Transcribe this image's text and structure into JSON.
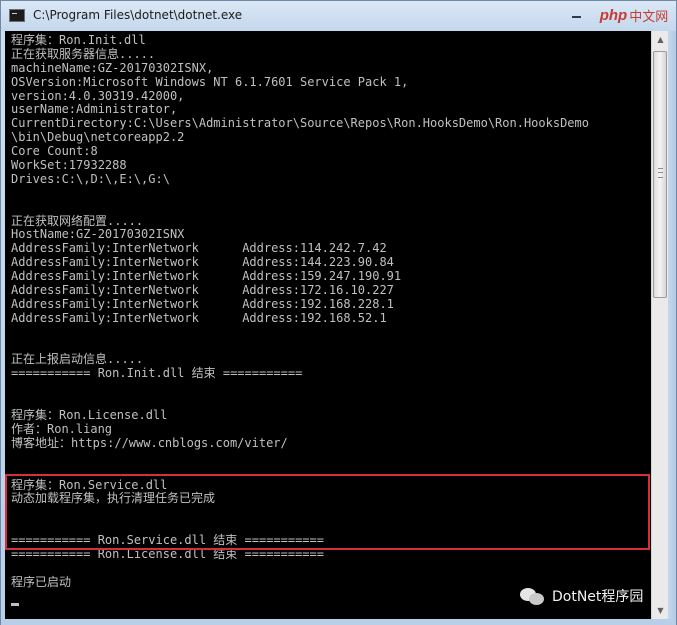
{
  "window": {
    "title": "C:\\Program Files\\dotnet\\dotnet.exe",
    "watermark": {
      "brand": "php",
      "suffix": "中文网"
    }
  },
  "console": {
    "lines": [
      "程序集：Ron.Init.dll",
      "正在获取服务器信息.....",
      "machineName:GZ-20170302ISNX,",
      "OSVersion:Microsoft Windows NT 6.1.7601 Service Pack 1,",
      "version:4.0.30319.42000,",
      "userName:Administrator,",
      "CurrentDirectory:C:\\Users\\Administrator\\Source\\Repos\\Ron.HooksDemo\\Ron.HooksDemo",
      "\\bin\\Debug\\netcoreapp2.2",
      "Core Count:8",
      "WorkSet:17932288",
      "Drives:C:\\,D:\\,E:\\,G:\\",
      "",
      "",
      "正在获取网络配置.....",
      "HostName:GZ-20170302ISNX",
      "AddressFamily:InterNetwork      Address:114.242.7.42",
      "AddressFamily:InterNetwork      Address:144.223.90.84",
      "AddressFamily:InterNetwork      Address:159.247.190.91",
      "AddressFamily:InterNetwork      Address:172.16.10.227",
      "AddressFamily:InterNetwork      Address:192.168.228.1",
      "AddressFamily:InterNetwork      Address:192.168.52.1",
      "",
      "",
      "正在上报启动信息.....",
      "=========== Ron.Init.dll 结束 ===========",
      "",
      "",
      "程序集：Ron.License.dll",
      "作者：Ron.liang",
      "博客地址：https://www.cnblogs.com/viter/",
      "",
      "",
      "程序集：Ron.Service.dll",
      "动态加载程序集，执行清理任务已完成",
      "",
      "",
      "=========== Ron.Service.dll 结束 ===========",
      "=========== Ron.License.dll 结束 ===========",
      "",
      "程序已启动"
    ]
  },
  "overlay": {
    "brand": "DotNet程序园",
    "icon": "wechat-icon"
  },
  "colors": {
    "console_bg": "#000000",
    "console_text": "#c0c0c0",
    "highlight": "#d3303a",
    "watermark": "#c63b32"
  }
}
